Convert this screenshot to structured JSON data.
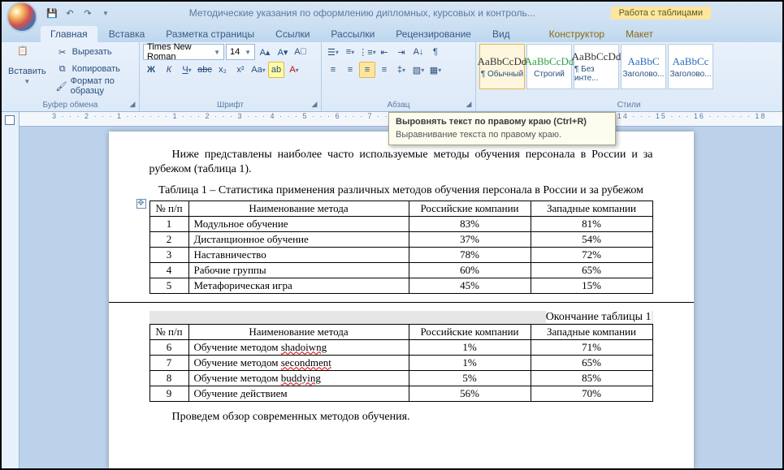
{
  "titlebar": {
    "title": "Методические указания по оформлению дипломных, курсовых и контроль...",
    "context_tab": "Работа с таблицами"
  },
  "tabs": [
    "Главная",
    "Вставка",
    "Разметка страницы",
    "Ссылки",
    "Рассылки",
    "Рецензирование",
    "Вид"
  ],
  "ctx_tabs": [
    "Конструктор",
    "Макет"
  ],
  "active_tab": "Главная",
  "clipboard": {
    "paste": "Вставить",
    "cut": "Вырезать",
    "copy": "Копировать",
    "format_painter": "Формат по образцу",
    "group": "Буфер обмена"
  },
  "font": {
    "name": "Times New Roman",
    "size": "14",
    "group": "Шрифт",
    "bold": "Ж",
    "italic": "К",
    "underline": "Ч",
    "strike": "abc",
    "sub": "x₂",
    "sup": "x²",
    "case": "Aa",
    "clear": "A"
  },
  "para": {
    "group": "Абзац"
  },
  "styles": {
    "group": "Стили",
    "items": [
      {
        "preview": "AaBbCcDd",
        "label": "¶ Обычный"
      },
      {
        "preview": "AaBbCcDd",
        "label": "Строгий"
      },
      {
        "preview": "AaBbCcDd",
        "label": "¶ Без инте..."
      },
      {
        "preview": "AaBbC",
        "label": "Заголово..."
      },
      {
        "preview": "AaBbCc",
        "label": "Заголово..."
      }
    ]
  },
  "tooltip": {
    "title": "Выровнять текст по правому краю (Ctrl+R)",
    "body": "Выравнивание текста по правому краю."
  },
  "ruler": "3 · · · 2 · · · 1 · · ·   · · · 1 · · · 2 · · · 3 · · · 4 · · · 5 · · · 6 · · · 7 · · · 8 · · · 9 · · · 10 · · · 11 · · · 12 · · · 13 · · · 14 · · · 15 · · · 16 · · ·   · · · 18",
  "doc": {
    "intro": "Ниже представлены наиболее часто используемые методы обучения персонала в России и за рубежом (таблица 1).",
    "table_title": "Таблица 1 – Статистика применения различных методов обучения персонала в России и за рубежом",
    "headers": [
      "№ п/п",
      "Наименование метода",
      "Российские компании",
      "Западные компании"
    ],
    "rows1": [
      {
        "n": "1",
        "name": "Модульное обучение",
        "ru": "83%",
        "west": "81%"
      },
      {
        "n": "2",
        "name": "Дистанционное обучение",
        "ru": "37%",
        "west": "54%"
      },
      {
        "n": "3",
        "name": "Наставничество",
        "ru": "78%",
        "west": "72%"
      },
      {
        "n": "4",
        "name": "Рабочие группы",
        "ru": "60%",
        "west": "65%"
      },
      {
        "n": "5",
        "name": "Метафорическая игра",
        "ru": "45%",
        "west": "15%"
      }
    ],
    "continuation": "Окончание таблицы 1",
    "rows2": [
      {
        "n": "6",
        "name": "Обучение методом ",
        "sq": "shadoiwng",
        "ru": "1%",
        "west": "71%"
      },
      {
        "n": "7",
        "name": "Обучение методом ",
        "sq": "secondment",
        "ru": "1%",
        "west": "65%"
      },
      {
        "n": "8",
        "name": "Обучение методом ",
        "sq": "buddying",
        "ru": "5%",
        "west": "85%"
      },
      {
        "n": "9",
        "name": "Обучение действием",
        "sq": "",
        "ru": "56%",
        "west": "70%"
      }
    ],
    "outro": "Проведем обзор современных методов обучения."
  }
}
